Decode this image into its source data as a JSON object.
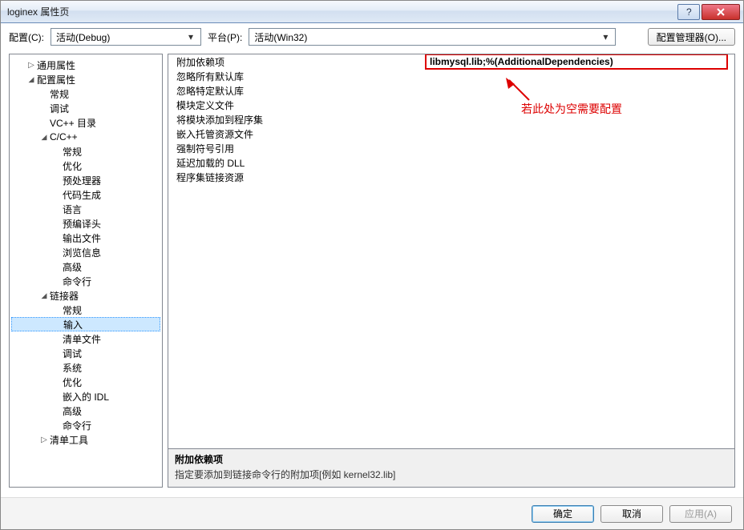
{
  "window": {
    "title": "loginex 属性页"
  },
  "toolbar": {
    "config_label": "配置(C):",
    "config_value": "活动(Debug)",
    "platform_label": "平台(P):",
    "platform_value": "活动(Win32)",
    "manager_btn": "配置管理器(O)..."
  },
  "tree": [
    {
      "label": "通用属性",
      "level": 1,
      "arrow": "closed"
    },
    {
      "label": "配置属性",
      "level": 1,
      "arrow": "open"
    },
    {
      "label": "常规",
      "level": 2
    },
    {
      "label": "调试",
      "level": 2
    },
    {
      "label": "VC++ 目录",
      "level": 2
    },
    {
      "label": "C/C++",
      "level": 2,
      "arrow": "open"
    },
    {
      "label": "常规",
      "level": 3
    },
    {
      "label": "优化",
      "level": 3
    },
    {
      "label": "预处理器",
      "level": 3
    },
    {
      "label": "代码生成",
      "level": 3
    },
    {
      "label": "语言",
      "level": 3
    },
    {
      "label": "预编译头",
      "level": 3
    },
    {
      "label": "输出文件",
      "level": 3
    },
    {
      "label": "浏览信息",
      "level": 3
    },
    {
      "label": "高级",
      "level": 3
    },
    {
      "label": "命令行",
      "level": 3
    },
    {
      "label": "链接器",
      "level": 2,
      "arrow": "open"
    },
    {
      "label": "常规",
      "level": 3
    },
    {
      "label": "输入",
      "level": 3,
      "selected": true
    },
    {
      "label": "清单文件",
      "level": 3
    },
    {
      "label": "调试",
      "level": 3
    },
    {
      "label": "系统",
      "level": 3
    },
    {
      "label": "优化",
      "level": 3
    },
    {
      "label": "嵌入的 IDL",
      "level": 3
    },
    {
      "label": "高级",
      "level": 3
    },
    {
      "label": "命令行",
      "level": 3
    },
    {
      "label": "清单工具",
      "level": 2,
      "arrow": "closed"
    }
  ],
  "properties": [
    {
      "name": "附加依赖项",
      "value": "libmysql.lib;%(AdditionalDependencies)",
      "highlighted": true
    },
    {
      "name": "忽略所有默认库",
      "value": ""
    },
    {
      "name": "忽略特定默认库",
      "value": ""
    },
    {
      "name": "模块定义文件",
      "value": ""
    },
    {
      "name": "将模块添加到程序集",
      "value": ""
    },
    {
      "name": "嵌入托管资源文件",
      "value": ""
    },
    {
      "name": "强制符号引用",
      "value": ""
    },
    {
      "name": "延迟加载的 DLL",
      "value": ""
    },
    {
      "name": "程序集链接资源",
      "value": ""
    }
  ],
  "annotation": "若此处为空需要配置",
  "description": {
    "title": "附加依赖项",
    "text": "指定要添加到链接命令行的附加项[例如 kernel32.lib]"
  },
  "footer": {
    "ok": "确定",
    "cancel": "取消",
    "apply": "应用(A)"
  }
}
